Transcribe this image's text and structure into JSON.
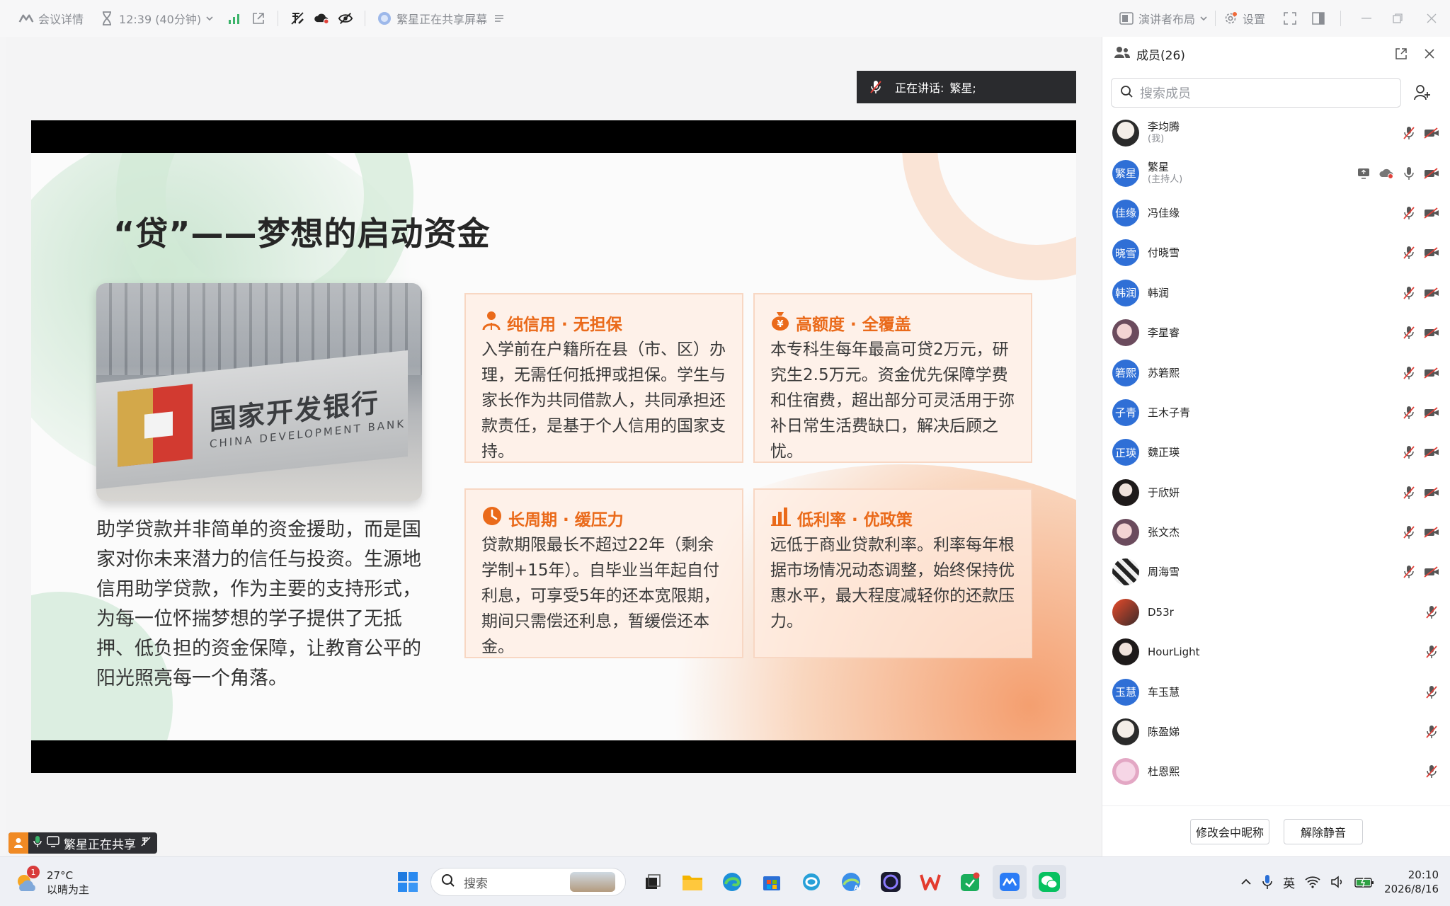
{
  "toolbar": {
    "meeting_details": "会议详情",
    "timer": "12:39 (40分钟)",
    "sharing_status": "繁星正在共享屏幕",
    "speaker_layout": "演讲者布局",
    "settings": "设置"
  },
  "speaker_bar": {
    "label": "正在讲话:",
    "name": "繁星;"
  },
  "slide": {
    "title": "“贷”——梦想的启动资金",
    "photo_sign_cn": "国家开发银行",
    "photo_sign_en": "CHINA DEVELOPMENT BANK",
    "body": "助学贷款并非简单的资金援助，而是国家对你未来潜力的信任与投资。生源地信用助学贷款，作为主要的支持形式，为每一位怀揣梦想的学子提供了无抵押、低负担的资金保障，让教育公平的阳光照亮每一个角落。",
    "cards": [
      {
        "title": "纯信用 · 无担保",
        "icon": "person-icon",
        "text": "入学前在户籍所在县（市、区）办理，无需任何抵押或担保。学生与家长作为共同借款人，共同承担还款责任，是基于个人信用的国家支持。"
      },
      {
        "title": "高额度 · 全覆盖",
        "icon": "money-bag-icon",
        "text": "本专科生每年最高可贷2万元，研究生2.5万元。资金优先保障学费和住宿费，超出部分可灵活用于弥补日常生活费缺口，解决后顾之忧。"
      },
      {
        "title": "长周期 · 缓压力",
        "icon": "clock-icon",
        "text": "贷款期限最长不超过22年（剩余学制+15年）。自毕业当年起自付利息，可享受5年的还本宽限期，期间只需偿还利息，暂缓偿还本金。"
      },
      {
        "title": "低利率 · 优政策",
        "icon": "bar-chart-icon",
        "text": "远低于商业贷款利率。利率每年根据市场情况动态调整，始终保持优惠水平，最大程度减轻你的还款压力。"
      }
    ]
  },
  "share_pill": {
    "text": "繁星正在共享"
  },
  "panel": {
    "title": "成员(26)",
    "search_placeholder": "搜索成员",
    "members": [
      {
        "name": "李均腾",
        "sub": "(我)",
        "avatar_text": "",
        "avatar_style": "av-photo",
        "icons": [
          "mic-muted-icon",
          "camera-off-icon"
        ]
      },
      {
        "name": "繁星",
        "sub": "(主持人)",
        "avatar_text": "繁星",
        "avatar_style": "av-blue",
        "icons": [
          "screen-share-icon",
          "cloud-record-icon",
          "mic-icon",
          "camera-off-icon"
        ]
      },
      {
        "name": "冯佳缘",
        "sub": "",
        "avatar_text": "佳缘",
        "avatar_style": "av-blue",
        "icons": [
          "mic-muted-icon",
          "camera-off-icon"
        ]
      },
      {
        "name": "付晓雪",
        "sub": "",
        "avatar_text": "晓雪",
        "avatar_style": "av-blue",
        "icons": [
          "mic-muted-icon",
          "camera-off-icon"
        ]
      },
      {
        "name": "韩润",
        "sub": "",
        "avatar_text": "韩润",
        "avatar_style": "av-blue",
        "icons": [
          "mic-muted-icon",
          "camera-off-icon"
        ]
      },
      {
        "name": "李星睿",
        "sub": "",
        "avatar_text": "",
        "avatar_style": "av-photo2",
        "icons": [
          "mic-muted-icon",
          "camera-off-icon"
        ]
      },
      {
        "name": "苏箬熙",
        "sub": "",
        "avatar_text": "箬熙",
        "avatar_style": "av-blue",
        "icons": [
          "mic-muted-icon",
          "camera-off-icon"
        ]
      },
      {
        "name": "王木子青",
        "sub": "",
        "avatar_text": "子青",
        "avatar_style": "av-blue",
        "icons": [
          "mic-muted-icon",
          "camera-off-icon"
        ]
      },
      {
        "name": "魏正瑛",
        "sub": "",
        "avatar_text": "正瑛",
        "avatar_style": "av-blue",
        "icons": [
          "mic-muted-icon",
          "camera-off-icon"
        ]
      },
      {
        "name": "于欣妍",
        "sub": "",
        "avatar_text": "",
        "avatar_style": "av-photo4",
        "icons": [
          "mic-muted-icon",
          "camera-off-icon"
        ]
      },
      {
        "name": "张文杰",
        "sub": "",
        "avatar_text": "",
        "avatar_style": "av-photo2",
        "icons": [
          "mic-muted-icon",
          "camera-off-icon"
        ]
      },
      {
        "name": "周海雪",
        "sub": "",
        "avatar_text": "",
        "avatar_style": "av-photo6",
        "icons": [
          "mic-muted-icon",
          "camera-off-icon"
        ]
      },
      {
        "name": "D53r",
        "sub": "",
        "avatar_text": "",
        "avatar_style": "av-photo3",
        "icons": [
          "mic-muted-icon"
        ]
      },
      {
        "name": "HourLight",
        "sub": "",
        "avatar_text": "",
        "avatar_style": "av-photo4",
        "icons": [
          "mic-muted-icon"
        ]
      },
      {
        "name": "车玉慧",
        "sub": "",
        "avatar_text": "玉慧",
        "avatar_style": "av-blue",
        "icons": [
          "mic-muted-icon"
        ]
      },
      {
        "name": "陈盈娣",
        "sub": "",
        "avatar_text": "",
        "avatar_style": "av-photo",
        "icons": [
          "mic-muted-icon"
        ]
      },
      {
        "name": "杜恩熙",
        "sub": "",
        "avatar_text": "",
        "avatar_style": "av-photo5",
        "icons": [
          "mic-muted-icon"
        ]
      }
    ],
    "rename_button": "修改会中昵称",
    "unmute_button": "解除静音"
  },
  "taskbar": {
    "weather_temp": "27°C",
    "weather_desc": "以晴为主",
    "weather_badge": "1",
    "search_label": "搜索",
    "ime": "英",
    "time": "20:10",
    "date": "2026/8/16"
  },
  "colors": {
    "accent_orange": "#ea6a1a",
    "avatar_blue": "#2f6fd6",
    "muted_red": "#e0413a"
  }
}
